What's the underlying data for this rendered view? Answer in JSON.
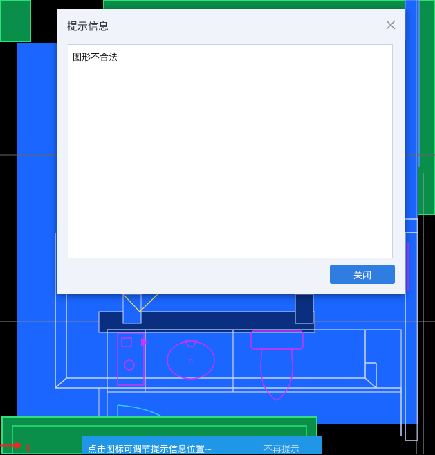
{
  "dialog": {
    "title": "提示信息",
    "message": "图形不合法",
    "close_button_label": "关闭",
    "close_icon": "close-icon"
  },
  "tip_bar": {
    "text": "点击图标可调节提示信息位置~",
    "dismiss_label": "不再提示"
  },
  "canvas": {
    "axis_label": "X",
    "colors": {
      "background": "#000000",
      "room_fill": "#1a66ff",
      "wall_outline": "#00a859",
      "fixture_outline": "#cc33ff",
      "accent_red": "#ff2020",
      "accent_yellow": "#ffee33",
      "accent_cyan": "#33ccff"
    }
  }
}
